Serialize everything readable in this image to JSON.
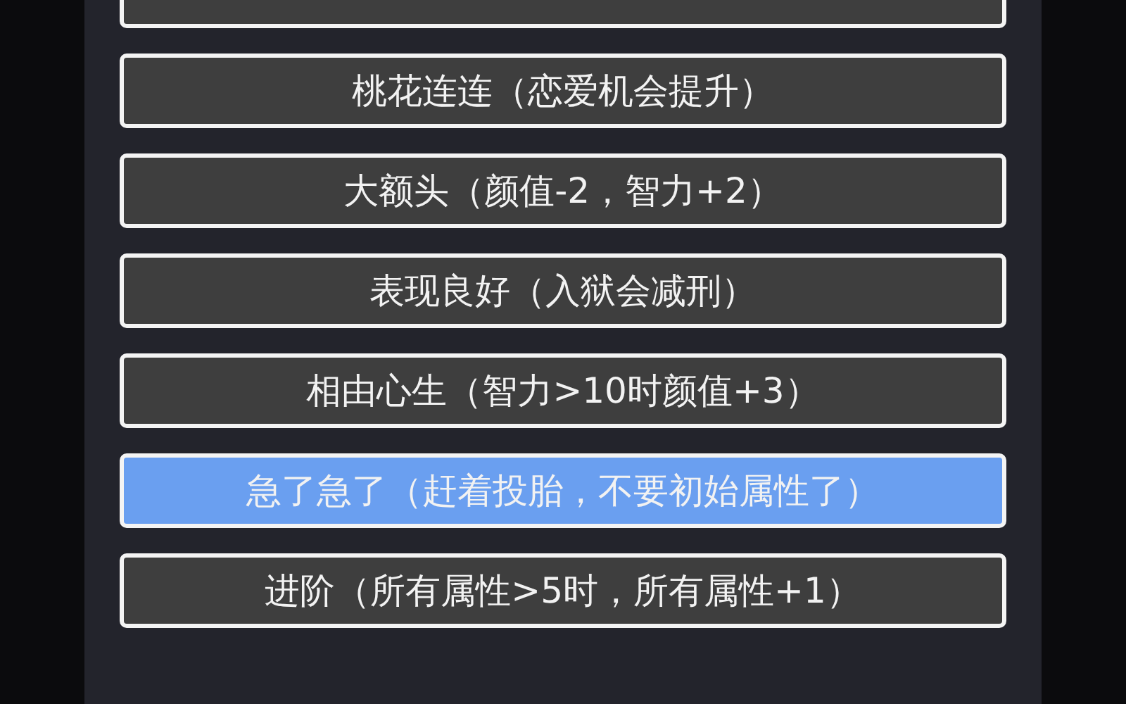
{
  "partial_option": {
    "selected": false
  },
  "options": [
    {
      "label": "桃花连连（恋爱机会提升）",
      "selected": false
    },
    {
      "label": "大额头（颜值-2，智力+2）",
      "selected": false
    },
    {
      "label": "表现良好（入狱会减刑）",
      "selected": false
    },
    {
      "label": "相由心生（智力>10时颜值+3）",
      "selected": false
    },
    {
      "label": "急了急了（赶着投胎，不要初始属性了）",
      "selected": true
    },
    {
      "label": "进阶（所有属性>5时，所有属性+1）",
      "selected": false
    }
  ]
}
